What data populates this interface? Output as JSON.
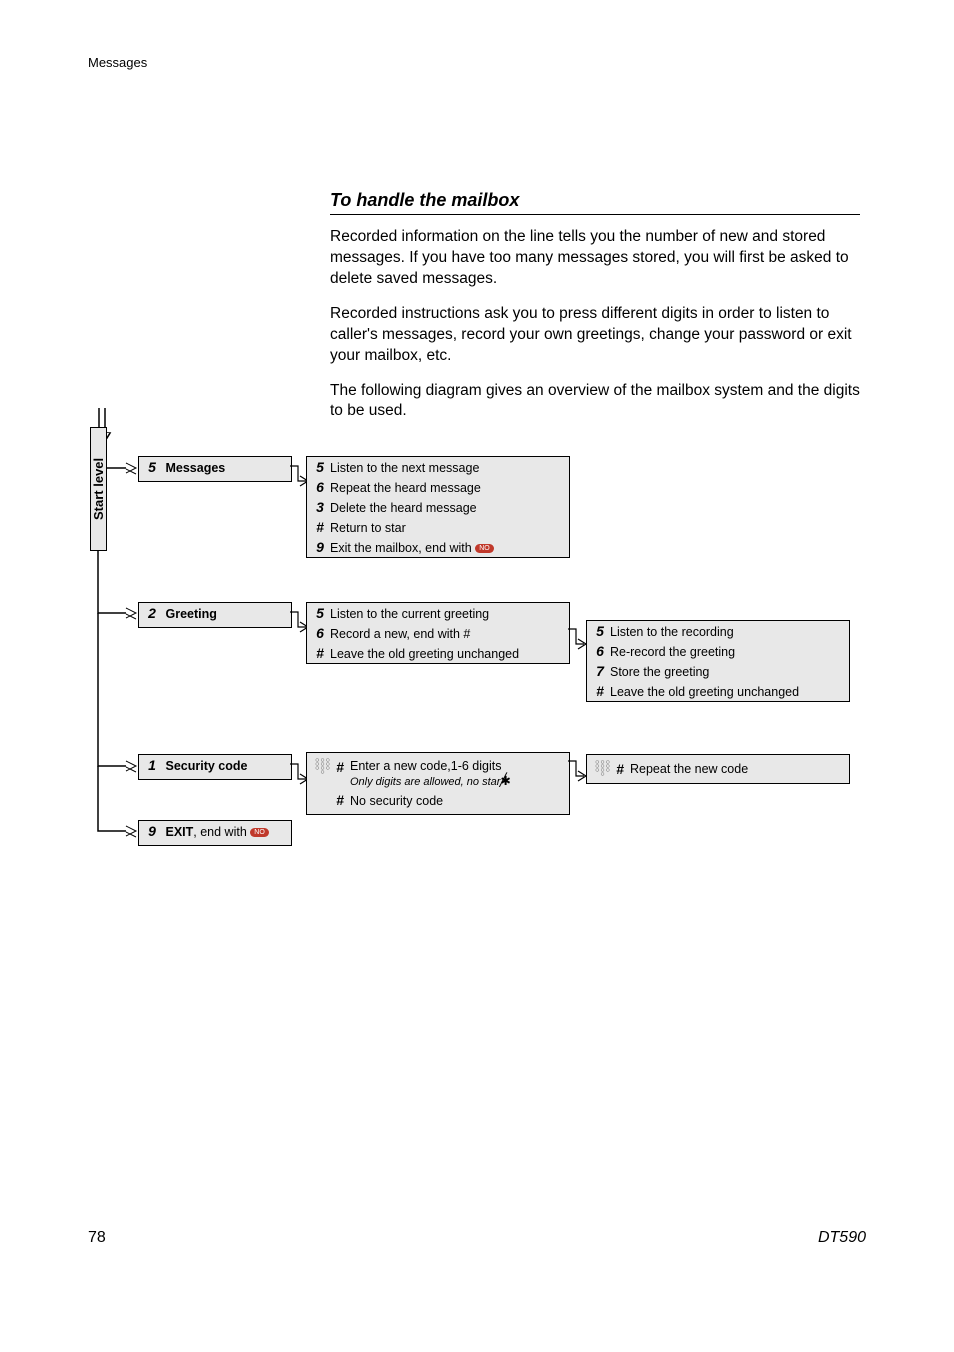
{
  "header": {
    "section": "Messages"
  },
  "subtitle": "To handle the mailbox",
  "para1": "Recorded information on the line tells you the number of new and stored messages. If you have too many messages stored, you will first be asked to delete saved messages.",
  "para2": "Recorded instructions ask you to press different digits in order to listen to caller's messages, record your own greetings, change your password or exit your mailbox, etc.",
  "para3": "The following diagram gives an overview of the mailbox system and the digits to be used.",
  "startLevel": "Start level",
  "menu": {
    "messages": {
      "key": "5",
      "label": "Messages"
    },
    "greeting": {
      "key": "2",
      "label": "Greeting"
    },
    "security": {
      "key": "1",
      "label": "Security code"
    },
    "exit": {
      "key": "9",
      "label": "EXIT",
      "suffix": ", end with"
    }
  },
  "messagesOpts": {
    "r1": {
      "k": "5",
      "t": "Listen to the next message"
    },
    "r2": {
      "k": "6",
      "t": "Repeat the heard message"
    },
    "r3": {
      "k": "3",
      "t": "Delete the heard message"
    },
    "r4": {
      "k": "#",
      "t": "Return to star"
    },
    "r5": {
      "k": "9",
      "t": "Exit the mailbox, end with"
    }
  },
  "greetingOpts": {
    "r1": {
      "k": "5",
      "t": "Listen to the current greeting"
    },
    "r2": {
      "k": "6",
      "t": "Record a new, end with #"
    },
    "r3": {
      "k": "#",
      "t": "Leave the old greeting unchanged"
    }
  },
  "greetingSub": {
    "r1": {
      "k": "5",
      "t": "Listen to the recording"
    },
    "r2": {
      "k": "6",
      "t": "Re-record the greeting"
    },
    "r3": {
      "k": "7",
      "t": "Store the greeting"
    },
    "r4": {
      "k": "#",
      "t": "Leave the old greeting unchanged"
    }
  },
  "securityOpts": {
    "r1": {
      "k": "#",
      "t": "Enter a new code,1-6 digits",
      "sub": "Only digits are allowed, no star"
    },
    "r2": {
      "k": "#",
      "t": "No security code"
    }
  },
  "securitySub": {
    "r1": {
      "k": "#",
      "t": "Repeat the new code"
    }
  },
  "noLabel": "NO",
  "footer": {
    "page": "78",
    "model": "DT590"
  }
}
